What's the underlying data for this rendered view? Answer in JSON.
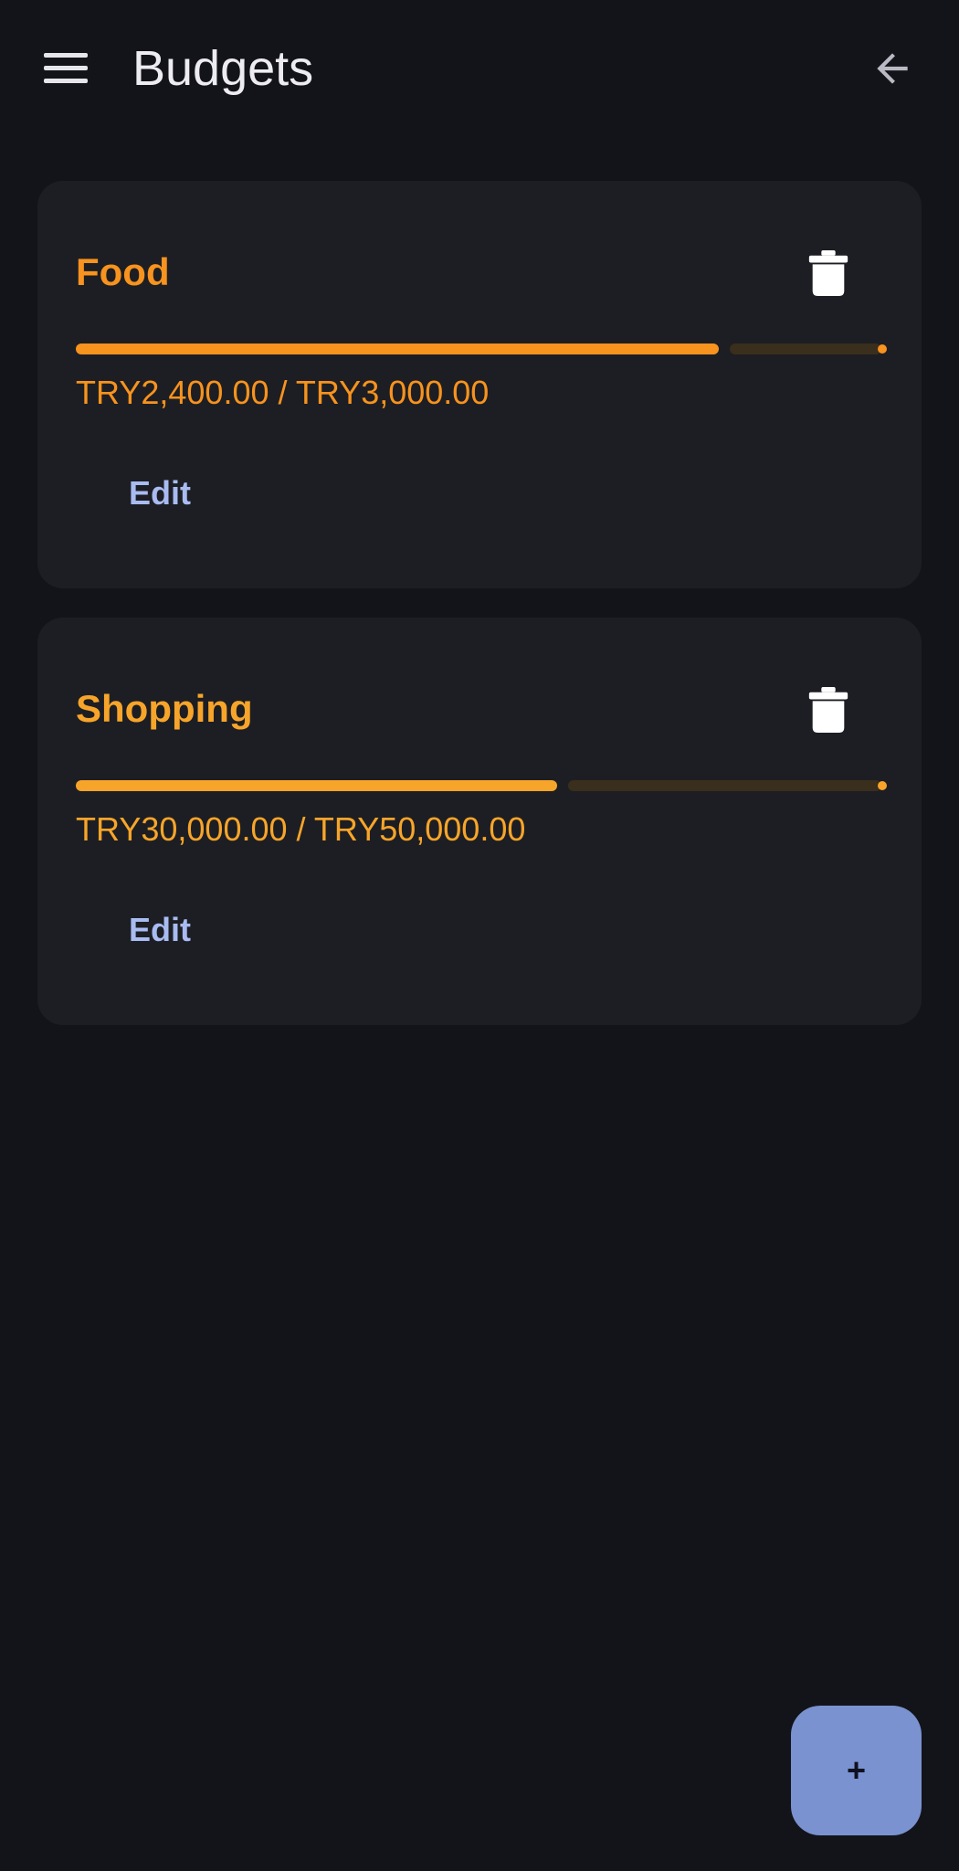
{
  "app_bar": {
    "title": "Budgets",
    "menu_icon": "hamburger-menu-icon",
    "back_icon": "arrow-left-icon"
  },
  "budgets": [
    {
      "name": "Food",
      "amount_text": "TRY2,400.00 / TRY3,000.00",
      "spent": 2400,
      "limit": 3000,
      "progress_fraction": 0.8,
      "color": "#f7931e",
      "edit_label": "Edit",
      "delete_icon": "trash-icon"
    },
    {
      "name": "Shopping",
      "amount_text": "TRY30,000.00 / TRY50,000.00",
      "spent": 30000,
      "limit": 50000,
      "progress_fraction": 0.6,
      "color": "#f7a52a",
      "edit_label": "Edit",
      "delete_icon": "trash-icon"
    }
  ],
  "fab": {
    "label": "+",
    "color": "#7a92cf"
  },
  "colors": {
    "background": "#13141a",
    "card": "#1d1e23",
    "edit_text": "#a8bcf2"
  }
}
